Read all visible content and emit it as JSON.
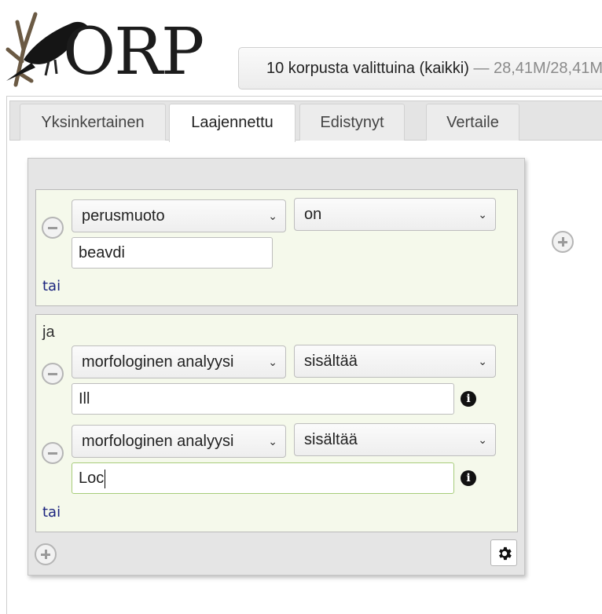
{
  "logo": {
    "text": "ORP"
  },
  "corpus": {
    "label": "10 korpusta valittuina (kaikki)",
    "count": " — 28,41M/28,41M"
  },
  "tabs": [
    {
      "label": "Yksinkertainen",
      "active": false
    },
    {
      "label": "Laajennettu",
      "active": true
    },
    {
      "label": "Edistynyt",
      "active": false
    },
    {
      "label": "Vertaile",
      "active": false
    }
  ],
  "tokens": [
    {
      "conditions": [
        {
          "attribute": "perusmuoto",
          "operator": "on",
          "value": "beavdi"
        }
      ],
      "or_label": "tai"
    },
    {
      "and_label": "ja",
      "conditions": [
        {
          "attribute": "morfologinen analyysi",
          "operator": "sisältää",
          "value": "Ill"
        },
        {
          "attribute": "morfologinen analyysi",
          "operator": "sisältää",
          "value": "Loc"
        }
      ],
      "or_label": "tai"
    }
  ],
  "icons": {
    "remove": "minus-circle-icon",
    "add": "plus-circle-icon",
    "info": "info-icon",
    "settings": "gear-icon",
    "chevron": "chevron-down-icon"
  }
}
